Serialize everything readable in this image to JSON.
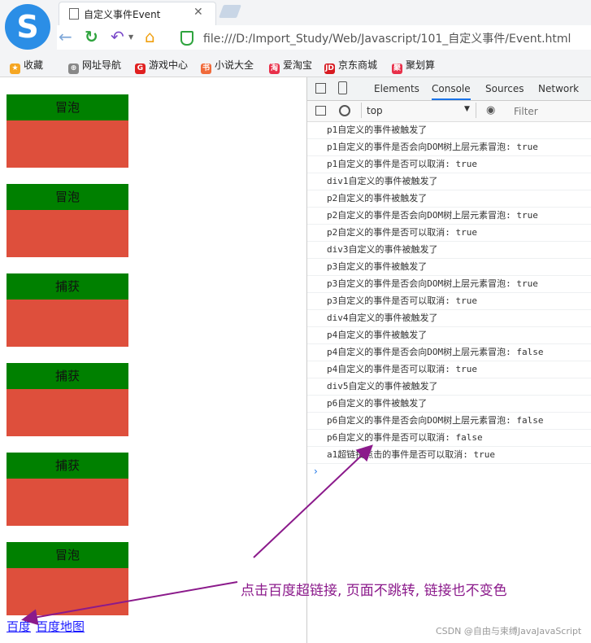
{
  "browser": {
    "tab_title": "自定义事件Event",
    "tab_close": "✕",
    "url": "file:///D:/Import_Study/Web/Javascript/101_自定义事件/Event.html",
    "logo_glyph": "S",
    "bookmarks": [
      {
        "label": "收藏",
        "icon": "star-icon",
        "glyph": "★",
        "color": "#f5a623"
      },
      {
        "label": "网址导航",
        "icon": "globe-icon",
        "glyph": "⊕",
        "color": "#888888"
      },
      {
        "label": "游戏中心",
        "icon": "game-icon",
        "glyph": "G",
        "color": "#e02020"
      },
      {
        "label": "小说大全",
        "icon": "book-icon",
        "glyph": "书",
        "color": "#f06a3a"
      },
      {
        "label": "爱淘宝",
        "icon": "taobao-icon",
        "glyph": "淘",
        "color": "#e8304a"
      },
      {
        "label": "京东商城",
        "icon": "jd-icon",
        "glyph": "JD",
        "color": "#d71920"
      },
      {
        "label": "聚划算",
        "icon": "juhuasuan-icon",
        "glyph": "聚",
        "color": "#e8304a"
      }
    ]
  },
  "page": {
    "boxes": [
      {
        "label": "冒泡"
      },
      {
        "label": "冒泡"
      },
      {
        "label": "捕获"
      },
      {
        "label": "捕获"
      },
      {
        "label": "捕获"
      },
      {
        "label": "冒泡"
      }
    ],
    "links": [
      "百度",
      "百度地图"
    ],
    "colors": {
      "box_header": "#008000",
      "box_body": "#de4f3c",
      "link": "#1a1aff"
    }
  },
  "devtools": {
    "tabs": [
      "Elements",
      "Console",
      "Sources",
      "Network"
    ],
    "active_tab": "Console",
    "context": "top",
    "filter_placeholder": "Filter",
    "prompt": "›",
    "logs": [
      "p1自定义的事件被触发了",
      "p1自定义的事件是否会向DOM树上层元素冒泡: true",
      "p1自定义的事件是否可以取消: true",
      "div1自定义的事件被触发了",
      "p2自定义的事件被触发了",
      "p2自定义的事件是否会向DOM树上层元素冒泡: true",
      "p2自定义的事件是否可以取消: true",
      "div3自定义的事件被触发了",
      "p3自定义的事件被触发了",
      "p3自定义的事件是否会向DOM树上层元素冒泡: true",
      "p3自定义的事件是否可以取消: true",
      "div4自定义的事件被触发了",
      "p4自定义的事件被触发了",
      "p4自定义的事件是否会向DOM树上层元素冒泡: false",
      "p4自定义的事件是否可以取消: true",
      "div5自定义的事件被触发了",
      "p6自定义的事件被触发了",
      "p6自定义的事件是否会向DOM树上层元素冒泡: false",
      "p6自定义的事件是否可以取消: false",
      "a1超链接点击的事件是否可以取消: true"
    ]
  },
  "annotation": {
    "text": "点击百度超链接, 页面不跳转, 链接也不变色",
    "color": "#8b1a8b"
  },
  "watermark": "CSDN @自由与束缚JavaJavaScript"
}
